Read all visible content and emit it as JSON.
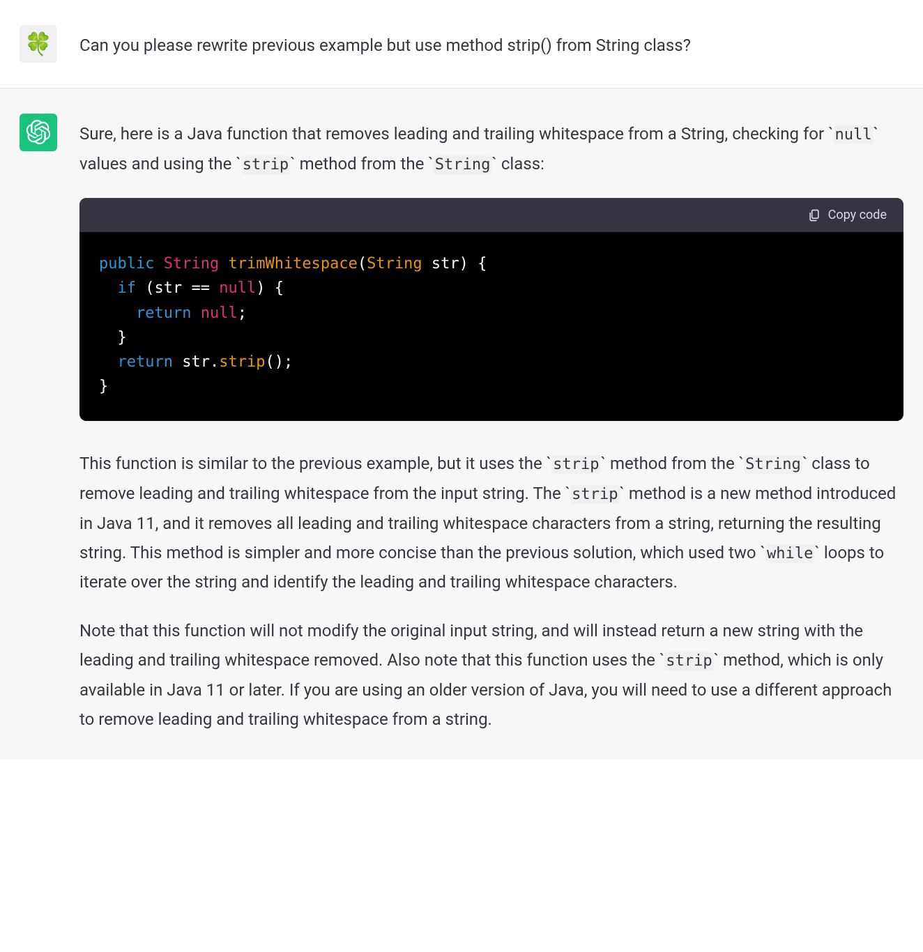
{
  "user": {
    "message": "Can you please rewrite previous example but use method strip() from String class?"
  },
  "assistant": {
    "intro_pre": "Sure, here is a Java function that removes leading and trailing whitespace from a String, checking for ",
    "intro_c1": "null",
    "intro_mid1": " values and using the ",
    "intro_c2": "strip",
    "intro_mid2": " method from the ",
    "intro_c3": "String",
    "intro_post": " class:",
    "copy_label": "Copy code",
    "code": {
      "t_public": "public",
      "t_String1": "String",
      "t_fn": "trimWhitespace",
      "t_lparen": "(",
      "t_String2": "String",
      "t_str1": " str",
      "t_rparen_brace": ") {",
      "t_if": "if",
      "t_if_cond_open": " (str == ",
      "t_null1": "null",
      "t_if_cond_close": ") {",
      "t_return1": "return",
      "t_null2": "null",
      "t_semi1": ";",
      "t_brace_close1": "}",
      "t_return2": "return",
      "t_str2": " str.",
      "t_strip": "strip",
      "t_call_end": "();",
      "t_brace_close2": "}"
    },
    "para1": {
      "p0": "This function is similar to the previous example, but it uses the ",
      "c1": "strip",
      "p1": " method from the ",
      "c2": "String",
      "p2": " class to remove leading and trailing whitespace from the input string. The ",
      "c3": "strip",
      "p3": " method is a new method introduced in Java 11, and it removes all leading and trailing whitespace characters from a string, returning the resulting string. This method is simpler and more concise than the previous solution, which used two ",
      "c4": "while",
      "p4": " loops to iterate over the string and identify the leading and trailing whitespace characters."
    },
    "para2": {
      "p0": "Note that this function will not modify the original input string, and will instead return a new string with the leading and trailing whitespace removed. Also note that this function uses the ",
      "c1": "strip",
      "p1": " method, which is only available in Java 11 or later. If you are using an older version of Java, you will need to use a different approach to remove leading and trailing whitespace from a string."
    }
  }
}
